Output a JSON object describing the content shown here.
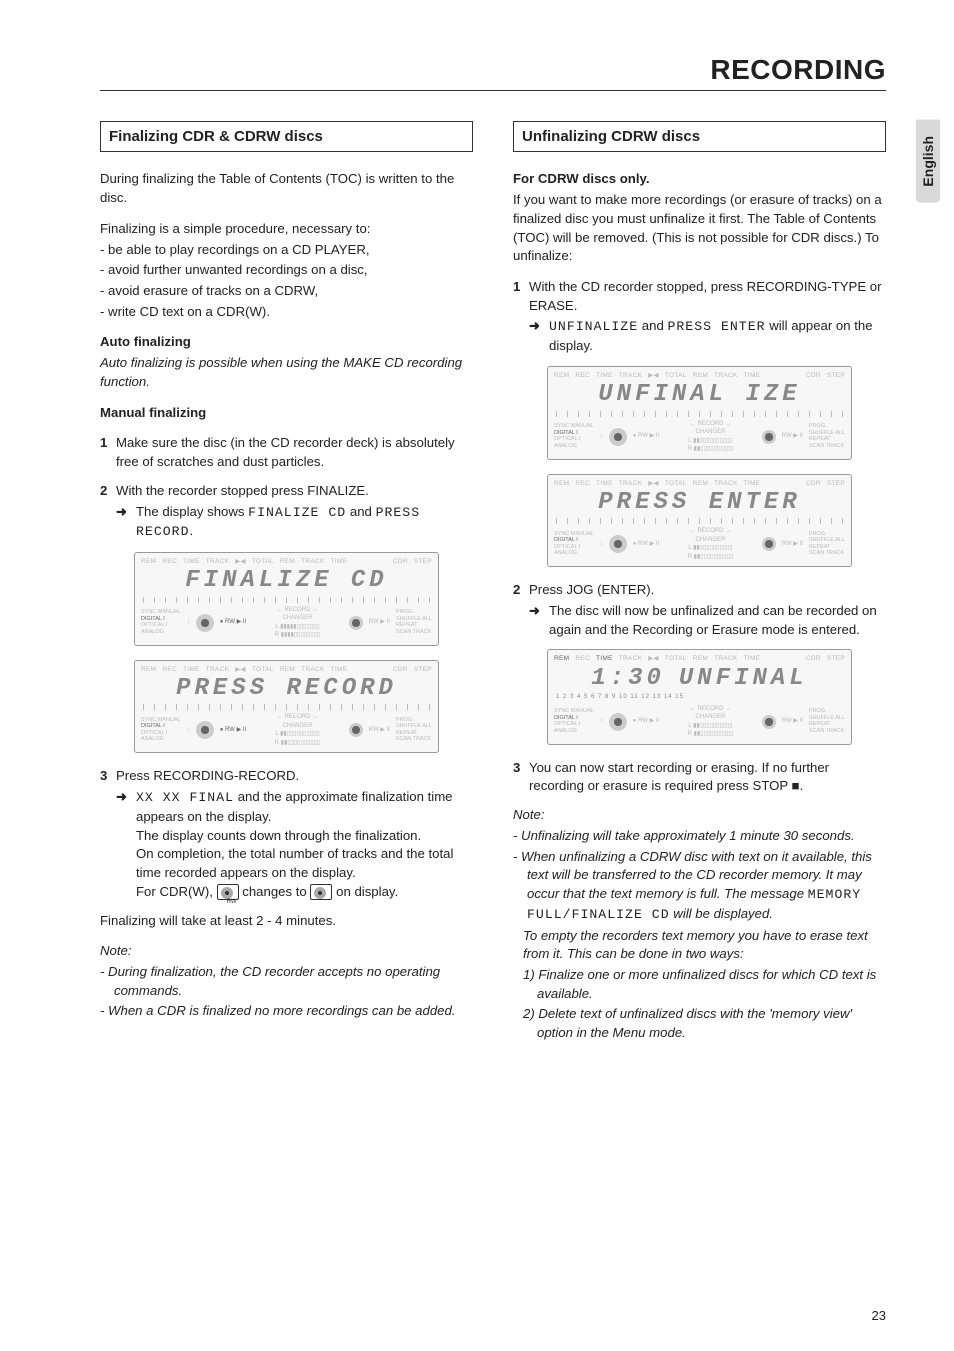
{
  "page_title": "RECORDING",
  "side_tab": "English",
  "page_number": "23",
  "left": {
    "section_heading": "Finalizing CDR & CDRW discs",
    "intro": "During finalizing the Table of Contents (TOC) is written to the disc.",
    "simple_proc_lead": "Finalizing is a simple procedure, necessary to:",
    "simple_proc_items": [
      "- be able to play recordings on a CD PLAYER,",
      "- avoid further unwanted recordings on a disc,",
      "- avoid erasure of tracks on a CDRW,",
      "- write CD text on a CDR(W)."
    ],
    "auto_head": "Auto finalizing",
    "auto_body": "Auto finalizing is possible when using the MAKE CD recording function.",
    "manual_head": "Manual finalizing",
    "step1": "Make sure the disc (in the CD recorder deck) is absolutely free of scratches and dust particles.",
    "step2_a": "With the recorder stopped press FINALIZE.",
    "step2_arrow_pre": "The display shows ",
    "step2_seg1": "FINALIZE CD",
    "step2_mid": " and ",
    "step2_seg2": "PRESS RECORD",
    "step2_post": ".",
    "lcd1_main": "FINALIZE CD",
    "lcd2_main": "PRESS RECORD",
    "step3_a": "Press RECORDING-RECORD.",
    "step3_arrow_seg": "XX XX FINAL",
    "step3_arrow_rest": " and the approximate finalization time appears on the display.",
    "step3_b": "The display counts down through the finalization.",
    "step3_c": "On completion, the total number of tracks and the total time recorded appears on the display.",
    "step3_d_pre": "For CDR(W), ",
    "step3_d_mid": " changes to ",
    "step3_d_post": " on display.",
    "finalize_time": "Finalizing will take at least 2 - 4 minutes.",
    "note_label": "Note:",
    "note1": "- During finalization, the CD recorder accepts no operating commands.",
    "note2": "- When a CDR is finalized no more recordings can be added.",
    "lcd_tags": {
      "top": [
        "REM",
        "REC",
        "TIME",
        "TRACK",
        "TOTAL",
        "REM",
        "TRACK",
        "TIME",
        "CDR",
        "STEP"
      ],
      "sync": "SYNC MANUAL",
      "dig": "DIGITAL I",
      "opt": "OPTICAL I",
      "ana": "ANALOG",
      "rw": "RW",
      "rec": "RECORD",
      "chg": "CHANGER",
      "prog": "PROG.",
      "shuf": "SHUFFLE   ALL",
      "rep": "REPEAT",
      "scan": "SCAN    TRACK"
    }
  },
  "right": {
    "section_heading": "Unfinalizing CDRW discs",
    "only": "For CDRW discs only.",
    "intro": "If you want to make more recordings (or erasure of tracks) on a finalized disc you must unfinalize it first. The Table of Contents (TOC) will be removed. (This is not possible for CDR discs.) To unfinalize:",
    "step1_a": "With the CD recorder stopped, press RECORDING-TYPE or ERASE.",
    "step1_arrow_seg1": "UNFINALIZE",
    "step1_arrow_mid": " and ",
    "step1_arrow_seg2": "PRESS ENTER",
    "step1_arrow_post": " will appear on the display.",
    "lcd1_main": "UNFINAL IZE",
    "lcd2_main": "PRESS ENTER",
    "step2_a": "Press JOG (ENTER).",
    "step2_arrow": "The disc will now be unfinalized and can be recorded on again and the Recording or Erasure mode is entered.",
    "lcd3_left": "1:30",
    "lcd3_right": "UNFINAL",
    "step3": "You can now start recording or erasing. If no further recording or erasure is required press STOP ■.",
    "note_label": "Note:",
    "note1": "- Unfinalizing will take approximately 1 minute 30 seconds.",
    "note2a": "- When unfinalizing a CDRW disc with text on it available, this text will be transferred to the CD recorder memory. It may occur that the text memory is full. The message",
    "note2_seg": "MEMORY FULL/FINALIZE CD",
    "note2b": " will be displayed.",
    "note2c": "To empty the recorders text memory you have to erase text from it. This can be done in two ways:",
    "note2_1": "1) Finalize one or more unfinalized discs for which CD text is available.",
    "note2_2": "2) Delete text of unfinalized discs with the 'memory view' option in the Menu mode."
  }
}
